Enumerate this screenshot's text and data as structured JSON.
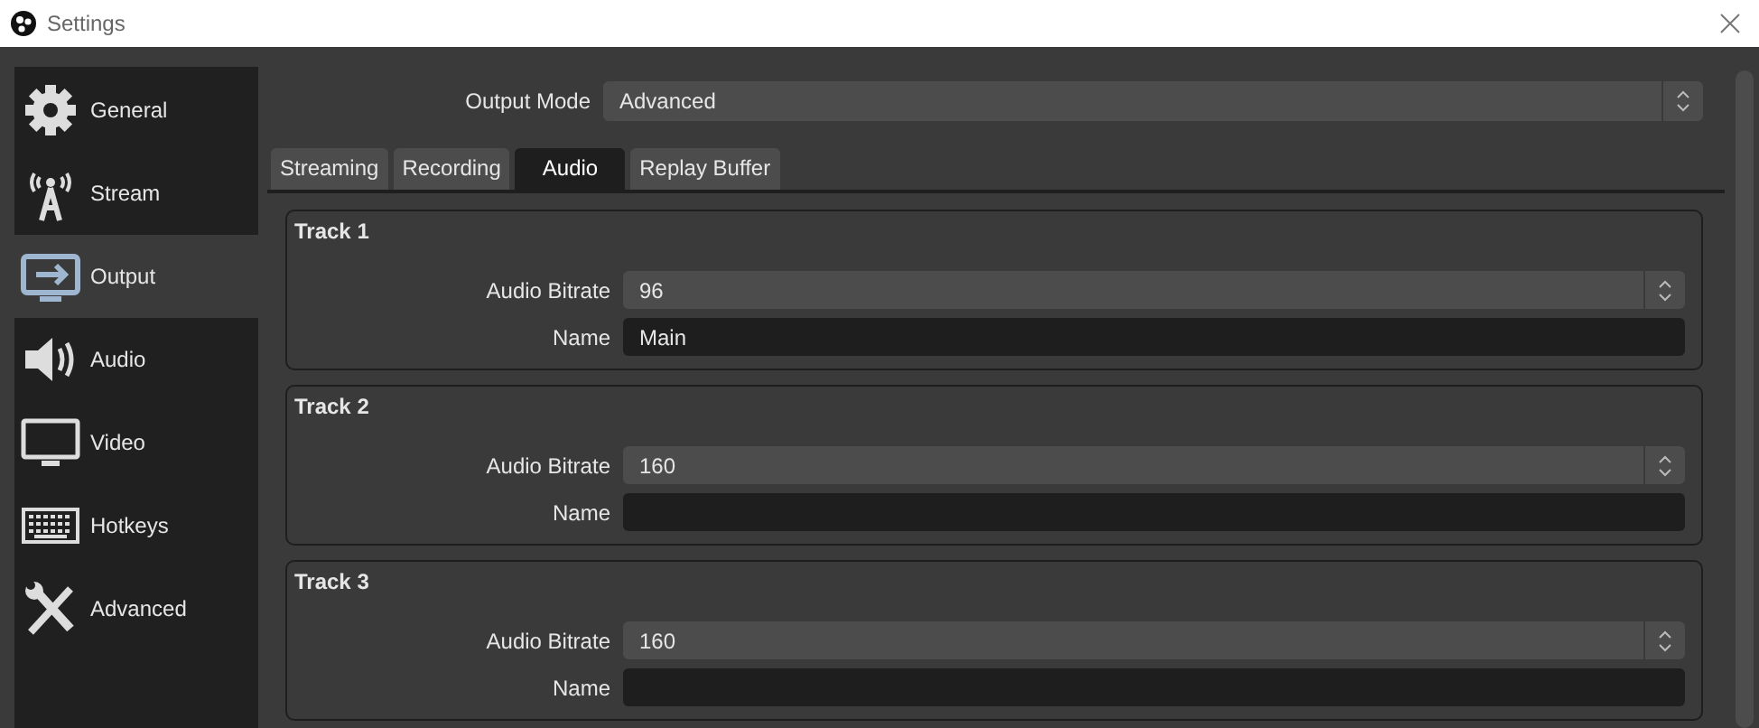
{
  "window": {
    "title": "Settings"
  },
  "sidebar": {
    "items": [
      {
        "label": "General",
        "kind": "gear",
        "selected": false
      },
      {
        "label": "Stream",
        "kind": "antenna",
        "selected": false
      },
      {
        "label": "Output",
        "kind": "output",
        "selected": true
      },
      {
        "label": "Audio",
        "kind": "speaker",
        "selected": false
      },
      {
        "label": "Video",
        "kind": "monitor",
        "selected": false
      },
      {
        "label": "Hotkeys",
        "kind": "keyboard",
        "selected": false
      },
      {
        "label": "Advanced",
        "kind": "tools",
        "selected": false
      }
    ]
  },
  "output_mode": {
    "label": "Output Mode",
    "value": "Advanced"
  },
  "tabs": [
    {
      "label": "Streaming",
      "selected": false
    },
    {
      "label": "Recording",
      "selected": false
    },
    {
      "label": "Audio",
      "selected": true
    },
    {
      "label": "Replay Buffer",
      "selected": false
    }
  ],
  "tracks": [
    {
      "title": "Track 1",
      "bitrate_label": "Audio Bitrate",
      "bitrate": "96",
      "name_label": "Name",
      "name": "Main"
    },
    {
      "title": "Track 2",
      "bitrate_label": "Audio Bitrate",
      "bitrate": "160",
      "name_label": "Name"
    },
    {
      "title": "Track 3",
      "bitrate_label": "Audio Bitrate",
      "bitrate": "160",
      "name_label": "Name"
    }
  ]
}
